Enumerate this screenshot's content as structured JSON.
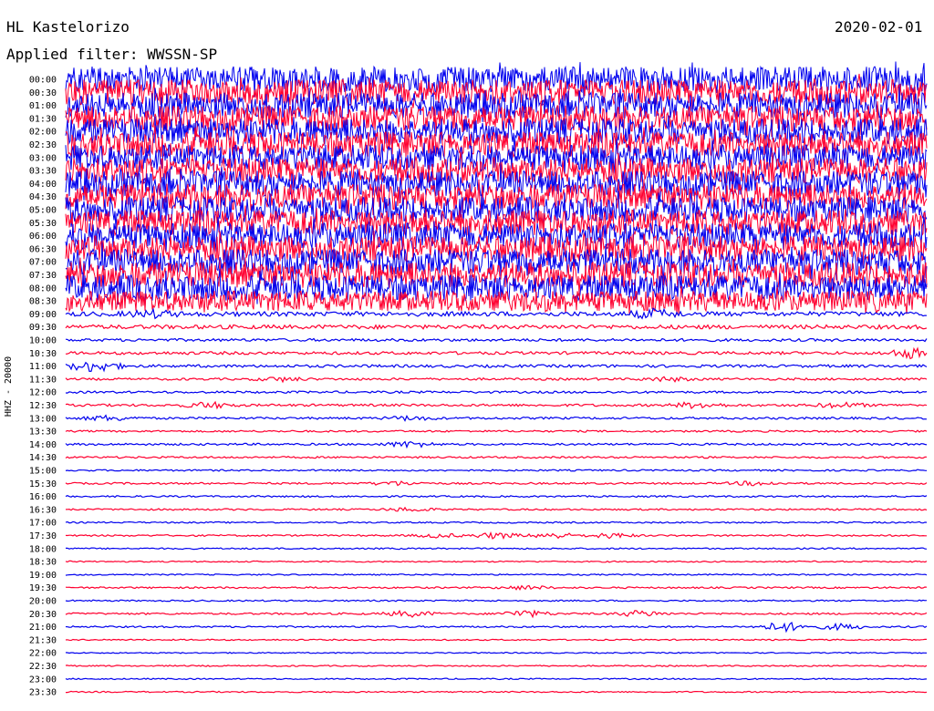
{
  "header": {
    "station": "HL Kastelorizo",
    "date": "2020-02-01",
    "filter": "Applied filter: WWSSN-SP"
  },
  "colors": {
    "blue": "#0000ee",
    "red": "#ff0030"
  },
  "chart_data": {
    "type": "line",
    "title": "HL Kastelorizo",
    "subtitle": "Applied filter: WWSSN-SP",
    "ylabel": "HHZ - 20000",
    "rows": [
      "00:00",
      "00:30",
      "01:00",
      "01:30",
      "02:00",
      "02:30",
      "03:00",
      "03:30",
      "04:00",
      "04:30",
      "05:00",
      "05:30",
      "06:00",
      "06:30",
      "07:00",
      "07:30",
      "08:00",
      "08:30",
      "09:00",
      "09:30",
      "10:00",
      "10:30",
      "11:00",
      "11:30",
      "12:00",
      "12:30",
      "13:00",
      "13:30",
      "14:00",
      "14:30",
      "15:00",
      "15:30",
      "16:00",
      "16:30",
      "17:00",
      "17:30",
      "18:00",
      "18:30",
      "19:00",
      "19:30",
      "20:00",
      "20:30",
      "21:00",
      "21:30",
      "22:00",
      "22:30",
      "23:00",
      "23:30"
    ],
    "series_colors": [
      "blue",
      "red"
    ],
    "xlim_minutes": [
      0,
      30
    ],
    "amplitude": [
      14,
      14,
      14,
      14,
      14,
      14,
      14,
      14,
      14,
      14,
      14,
      14,
      14,
      14,
      14,
      14,
      14,
      11,
      2.5,
      2.2,
      1.5,
      1.6,
      1.5,
      1.2,
      1.2,
      1.3,
      1.2,
      1.0,
      1.1,
      1.0,
      0.9,
      1.0,
      0.9,
      0.9,
      0.8,
      0.9,
      0.8,
      0.7,
      0.7,
      0.9,
      0.8,
      1.0,
      0.9,
      0.7,
      0.6,
      0.7,
      0.7,
      0.7
    ],
    "events": [
      {
        "row": "09:00",
        "minute": 20.5,
        "amplitude": 4
      },
      {
        "row": "09:00",
        "minute": 3.0,
        "amplitude": 3
      },
      {
        "row": "10:30",
        "minute": 29.5,
        "amplitude": 5
      },
      {
        "row": "11:00",
        "minute": 1.0,
        "amplitude": 6
      },
      {
        "row": "11:30",
        "minute": 7.5,
        "amplitude": 2
      },
      {
        "row": "11:30",
        "minute": 21.0,
        "amplitude": 2
      },
      {
        "row": "12:30",
        "minute": 5.0,
        "amplitude": 3
      },
      {
        "row": "12:30",
        "minute": 22.0,
        "amplitude": 3
      },
      {
        "row": "12:30",
        "minute": 27.0,
        "amplitude": 2.5
      },
      {
        "row": "13:00",
        "minute": 1.5,
        "amplitude": 2.5
      },
      {
        "row": "13:00",
        "minute": 12.0,
        "amplitude": 2
      },
      {
        "row": "14:00",
        "minute": 12.0,
        "amplitude": 3
      },
      {
        "row": "15:30",
        "minute": 11.5,
        "amplitude": 2
      },
      {
        "row": "15:30",
        "minute": 24.0,
        "amplitude": 2
      },
      {
        "row": "16:30",
        "minute": 12.0,
        "amplitude": 2
      },
      {
        "row": "17:30",
        "minute": 13.0,
        "amplitude": 2
      },
      {
        "row": "17:30",
        "minute": 15.0,
        "amplitude": 3
      },
      {
        "row": "17:30",
        "minute": 17.0,
        "amplitude": 3
      },
      {
        "row": "17:30",
        "minute": 19.0,
        "amplitude": 2.5
      },
      {
        "row": "19:30",
        "minute": 16.0,
        "amplitude": 2
      },
      {
        "row": "20:30",
        "minute": 12.0,
        "amplitude": 3
      },
      {
        "row": "20:30",
        "minute": 16.0,
        "amplitude": 3.5
      },
      {
        "row": "20:30",
        "minute": 20.0,
        "amplitude": 3
      },
      {
        "row": "21:00",
        "minute": 25.0,
        "amplitude": 5
      },
      {
        "row": "21:00",
        "minute": 27.0,
        "amplitude": 3
      }
    ]
  }
}
